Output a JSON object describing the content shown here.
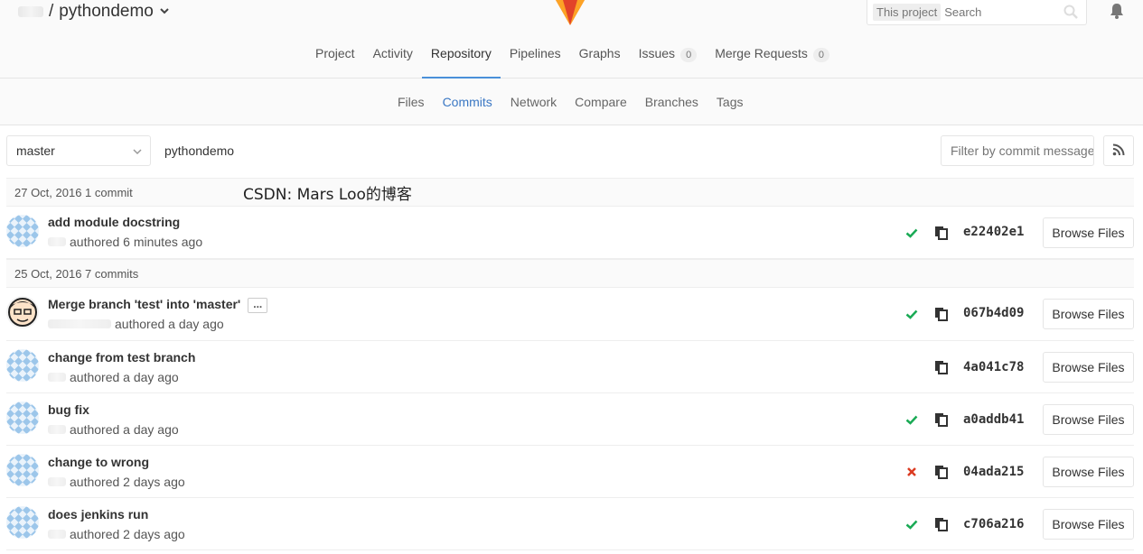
{
  "header": {
    "project_name": "pythondemo",
    "separator": "/",
    "search_scope": "This project",
    "search_placeholder": "Search"
  },
  "nav": {
    "items": [
      {
        "label": "Project"
      },
      {
        "label": "Activity"
      },
      {
        "label": "Repository",
        "active": true
      },
      {
        "label": "Pipelines"
      },
      {
        "label": "Graphs"
      },
      {
        "label": "Issues",
        "count": "0"
      },
      {
        "label": "Merge Requests",
        "count": "0"
      }
    ]
  },
  "subnav": {
    "items": [
      {
        "label": "Files"
      },
      {
        "label": "Commits",
        "active": true
      },
      {
        "label": "Network"
      },
      {
        "label": "Compare"
      },
      {
        "label": "Branches"
      },
      {
        "label": "Tags"
      }
    ]
  },
  "controls": {
    "branch": "master",
    "repo_crumb": "pythondemo",
    "filter_placeholder": "Filter by commit message"
  },
  "watermark": "CSDN: Mars Loo的博客",
  "days": [
    {
      "label": "27 Oct, 2016 1 commit"
    },
    {
      "label": "25 Oct, 2016 7 commits"
    }
  ],
  "commits": [
    {
      "title": "add module docstring",
      "meta": "authored 6 minutes ago",
      "status": "success",
      "sha": "e22402e1",
      "browse": "Browse Files"
    },
    {
      "title": "Merge branch 'test' into 'master'",
      "ellipsis": "...",
      "meta": "authored a day ago",
      "status": "success",
      "sha": "067b4d09",
      "browse": "Browse Files"
    },
    {
      "title": "change from test branch",
      "meta": "authored a day ago",
      "status": "none",
      "sha": "4a041c78",
      "browse": "Browse Files"
    },
    {
      "title": "bug fix",
      "meta": "authored a day ago",
      "status": "success",
      "sha": "a0addb41",
      "browse": "Browse Files"
    },
    {
      "title": "change to wrong",
      "meta": "authored 2 days ago",
      "status": "failed",
      "sha": "04ada215",
      "browse": "Browse Files"
    },
    {
      "title": "does jenkins run",
      "meta": "authored 2 days ago",
      "status": "success",
      "sha": "c706a216",
      "browse": "Browse Files"
    }
  ],
  "colors": {
    "success": "#1aaa55",
    "failed": "#db3b21",
    "active_tab": "#4a90d9",
    "link": "#3b78c4"
  }
}
